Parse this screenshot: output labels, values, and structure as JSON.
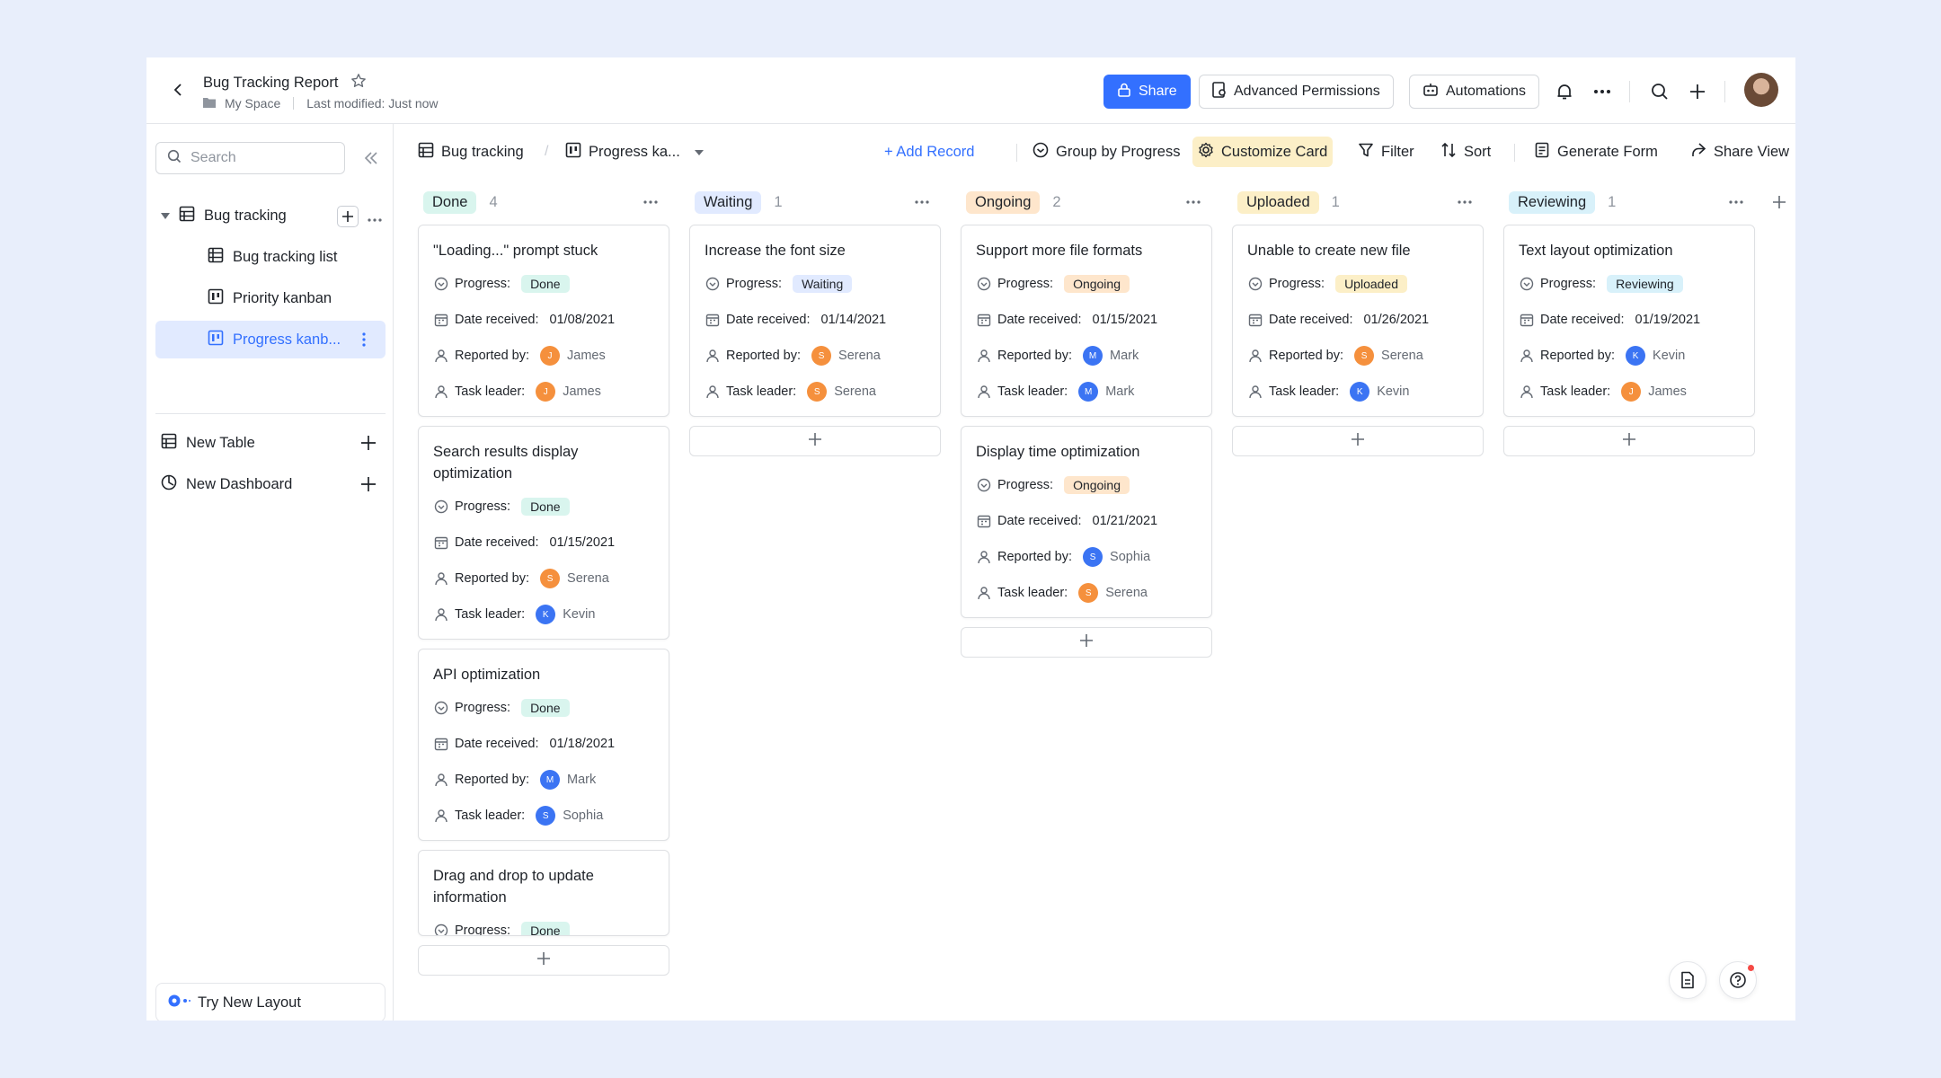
{
  "header": {
    "title": "Bug Tracking Report",
    "space": "My Space",
    "last_modified": "Last modified: Just now",
    "share_label": "Share",
    "permissions_label": "Advanced Permissions",
    "automations_label": "Automations"
  },
  "sidebar": {
    "search_placeholder": "Search",
    "base_name": "Bug tracking",
    "views": [
      "Bug tracking list",
      "Priority kanban",
      "Progress kanb..."
    ],
    "new_table": "New Table",
    "new_dashboard": "New Dashboard",
    "try_layout": "Try New Layout"
  },
  "toolbar": {
    "table": "Bug tracking",
    "view": "Progress ka...",
    "add_record": "+ Add Record",
    "group_by": "Group by Progress",
    "customize_card": "Customize Card",
    "filter": "Filter",
    "sort": "Sort",
    "generate_form": "Generate Form",
    "share_view": "Share View"
  },
  "field_labels": {
    "progress": "Progress:",
    "date": "Date received:",
    "reported": "Reported by:",
    "leader": "Task leader:"
  },
  "colors": {
    "done_bg": "#d9f5ee",
    "done_fg": "#1f2329",
    "waiting_bg": "#e1eaff",
    "waiting_fg": "#1f2329",
    "ongoing_bg": "#fee6cc",
    "ongoing_fg": "#1f2329",
    "uploaded_bg": "#fcefc7",
    "uploaded_fg": "#1f2329",
    "reviewing_bg": "#d8f1fa",
    "reviewing_fg": "#1f2329",
    "orange": "#f5903d",
    "blue": "#3b74f3"
  },
  "columns": [
    {
      "name": "Done",
      "count": "4",
      "cards": [
        {
          "title": "\"Loading...\" prompt stuck",
          "progress": "Done",
          "date": "01/08/2021",
          "reporter": "James",
          "reporter_initial": "J",
          "leader": "James",
          "leader_initial": "J"
        },
        {
          "title": "Search results display optimization",
          "progress": "Done",
          "date": "01/15/2021",
          "reporter": "Serena",
          "reporter_initial": "S",
          "leader": "Kevin",
          "leader_initial": "K"
        },
        {
          "title": "API optimization",
          "progress": "Done",
          "date": "01/18/2021",
          "reporter": "Mark",
          "reporter_initial": "M",
          "leader": "Sophia",
          "leader_initial": "S"
        },
        {
          "title": "Drag and drop to update information",
          "progress": "Done"
        }
      ]
    },
    {
      "name": "Waiting",
      "count": "1",
      "cards": [
        {
          "title": "Increase the font size",
          "progress": "Waiting",
          "date": "01/14/2021",
          "reporter": "Serena",
          "reporter_initial": "S",
          "leader": "Serena",
          "leader_initial": "S"
        }
      ]
    },
    {
      "name": "Ongoing",
      "count": "2",
      "cards": [
        {
          "title": "Support more file formats",
          "progress": "Ongoing",
          "date": "01/15/2021",
          "reporter": "Mark",
          "reporter_initial": "M",
          "leader": "Mark",
          "leader_initial": "M"
        },
        {
          "title": "Display time optimization",
          "progress": "Ongoing",
          "date": "01/21/2021",
          "reporter": "Sophia",
          "reporter_initial": "S",
          "leader": "Serena",
          "leader_initial": "S"
        }
      ]
    },
    {
      "name": "Uploaded",
      "count": "1",
      "cards": [
        {
          "title": "Unable to create new file",
          "progress": "Uploaded",
          "date": "01/26/2021",
          "reporter": "Serena",
          "reporter_initial": "S",
          "leader": "Kevin",
          "leader_initial": "K"
        }
      ]
    },
    {
      "name": "Reviewing",
      "count": "1",
      "cards": [
        {
          "title": "Text layout optimization",
          "progress": "Reviewing",
          "date": "01/19/2021",
          "reporter": "Kevin",
          "reporter_initial": "K",
          "leader": "James",
          "leader_initial": "J"
        }
      ]
    }
  ]
}
